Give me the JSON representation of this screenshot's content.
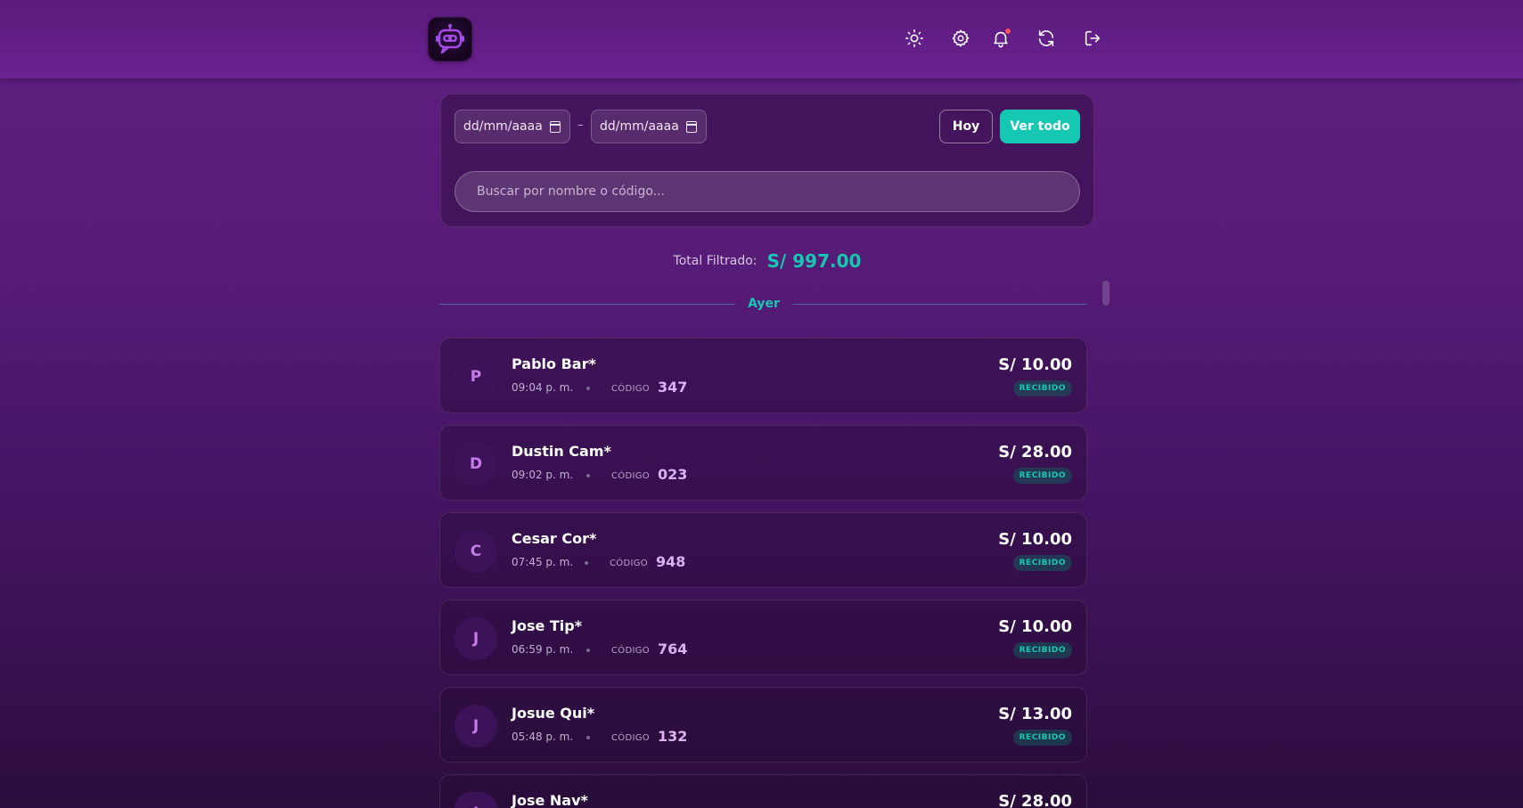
{
  "header": {
    "icons": [
      "sun-icon",
      "gear-icon",
      "bell-icon",
      "refresh-icon",
      "logout-icon"
    ]
  },
  "filters": {
    "date_from_placeholder": "dd/mm/aaaa",
    "date_separator": "–",
    "date_to_placeholder": "dd/mm/aaaa",
    "today_label": "Hoy",
    "see_all_label": "Ver todo",
    "search_placeholder": "Buscar por nombre o código..."
  },
  "summary": {
    "label": "Total Filtrado:",
    "value": "S/ 997.00"
  },
  "group": {
    "label": "Ayer"
  },
  "transactions": [
    {
      "initial": "P",
      "name": "Pablo Bar*",
      "time": "09:04 p. m.",
      "code_label": "CÓDIGO",
      "code": "347",
      "amount": "S/ 10.00",
      "status": "RECIBIDO"
    },
    {
      "initial": "D",
      "name": "Dustin Cam*",
      "time": "09:02 p. m.",
      "code_label": "CÓDIGO",
      "code": "023",
      "amount": "S/ 28.00",
      "status": "RECIBIDO"
    },
    {
      "initial": "C",
      "name": "Cesar Cor*",
      "time": "07:45 p. m.",
      "code_label": "CÓDIGO",
      "code": "948",
      "amount": "S/ 10.00",
      "status": "RECIBIDO"
    },
    {
      "initial": "J",
      "name": "Jose Tip*",
      "time": "06:59 p. m.",
      "code_label": "CÓDIGO",
      "code": "764",
      "amount": "S/ 10.00",
      "status": "RECIBIDO"
    },
    {
      "initial": "J",
      "name": "Josue Qui*",
      "time": "05:48 p. m.",
      "code_label": "CÓDIGO",
      "code": "132",
      "amount": "S/ 13.00",
      "status": "RECIBIDO"
    },
    {
      "initial": "J",
      "name": "Jose Nav*",
      "amount": "S/ 28.00"
    }
  ],
  "colors": {
    "accent": "#14c8b4",
    "background": "#4a1668",
    "avatar_text": "#c57be8",
    "code_text": "#d9b3f0"
  }
}
